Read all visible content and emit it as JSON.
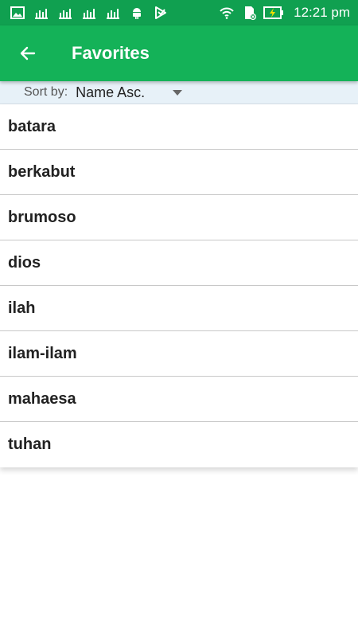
{
  "status_bar": {
    "time": "12:21 pm",
    "icons": [
      "image-icon",
      "chart-icon",
      "chart-icon",
      "chart-icon",
      "chart-icon",
      "android-icon",
      "play-store-icon",
      "wifi-icon",
      "sd-card-icon",
      "battery-charging-icon"
    ]
  },
  "app_bar": {
    "title": "Favorites",
    "back_icon": "arrow-left-icon"
  },
  "sort": {
    "label": "Sort by:",
    "selected": "Name Asc."
  },
  "favorites": [
    "batara",
    "berkabut",
    "brumoso",
    "dios",
    "ilah",
    "ilam-ilam",
    "mahaesa",
    "tuhan"
  ],
  "colors": {
    "status_bar": "#10a050",
    "app_bar": "#14b258",
    "sort_bar": "#e7f1f8"
  }
}
